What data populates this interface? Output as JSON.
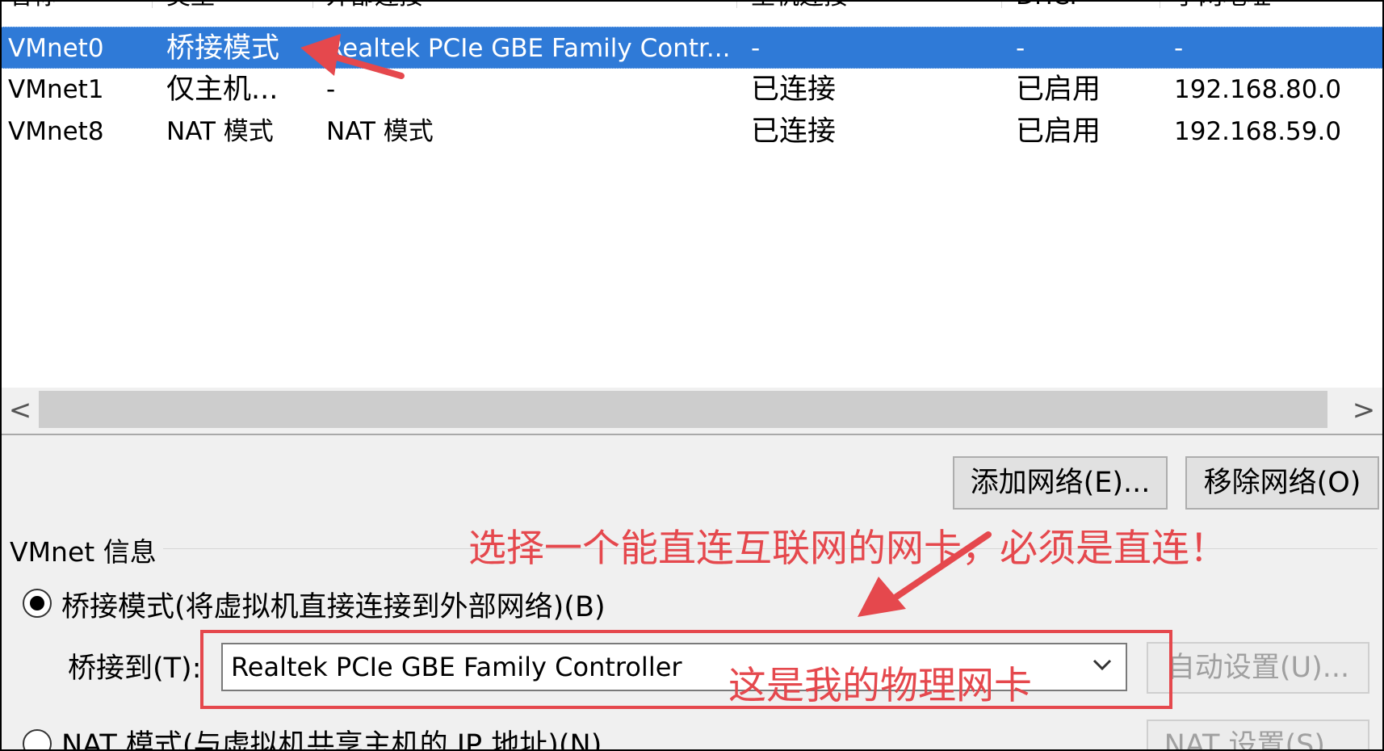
{
  "columns": [
    "名称",
    "类型",
    "外部连接",
    "主机连接",
    "DHCP",
    "子网地址"
  ],
  "rows": [
    {
      "name": "VMnet0",
      "type": "桥接模式",
      "external": "Realtek PCIe GBE Family Contr...",
      "host": "-",
      "dhcp": "-",
      "subnet": "-",
      "selected": true
    },
    {
      "name": "VMnet1",
      "type": "仅主机...",
      "external": "-",
      "host": "已连接",
      "dhcp": "已启用",
      "subnet": "192.168.80.0",
      "selected": false
    },
    {
      "name": "VMnet8",
      "type": "NAT 模式",
      "external": "NAT 模式",
      "host": "已连接",
      "dhcp": "已启用",
      "subnet": "192.168.59.0",
      "selected": false
    }
  ],
  "scrollbar": {
    "left_arrow": "<",
    "right_arrow": ">"
  },
  "buttons": {
    "add_network": "添加网络(E)...",
    "remove_network": "移除网络(O)",
    "auto_settings": "自动设置(U)...",
    "nat_settings": "NAT 设置(S)..."
  },
  "vmnet_info": {
    "group_label": "VMnet 信息",
    "bridged_radio": "桥接模式(将虚拟机直接连接到外部网络)(B)",
    "bridge_to_label": "桥接到(T):",
    "bridge_to_value": "Realtek PCIe GBE Family Controller",
    "nat_radio": "NAT 模式(与虚拟机共享主机的 IP 地址)(N)"
  },
  "annotations": {
    "top_note": "选择一个能直连互联网的网卡，必须是直连！",
    "combo_note": "这是我的物理网卡"
  },
  "colors": {
    "selection": "#2f7ad7",
    "annotation": "#e5484d"
  }
}
